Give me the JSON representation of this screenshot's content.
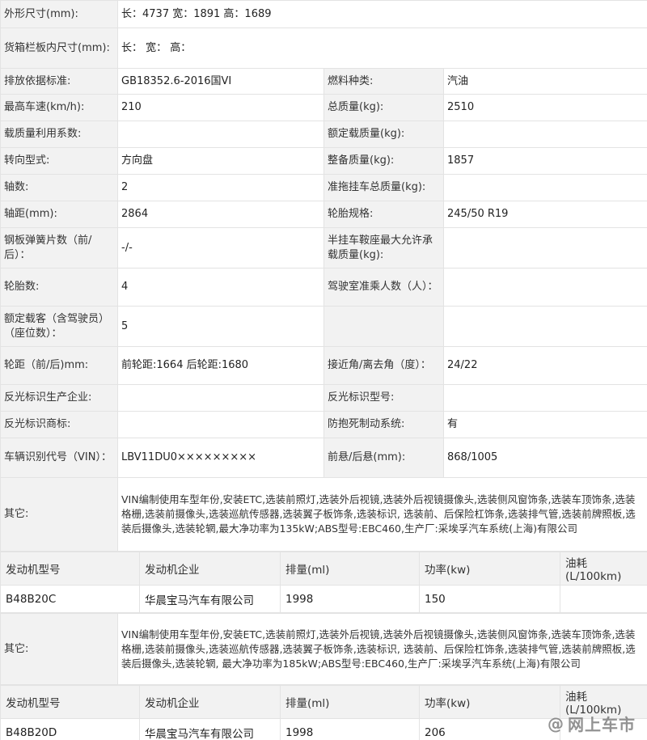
{
  "spec_rows": [
    {
      "type": "span",
      "label": "外形尺寸(mm):",
      "value": "长：4737 宽：1891 高：1689",
      "h": 34
    },
    {
      "type": "span",
      "label": "货箱栏板内尺寸(mm):",
      "value": "长：  宽：  高：",
      "h": 50
    },
    {
      "type": "pair",
      "l1": "排放依据标准:",
      "v1": "GB18352.6-2016国VI",
      "l2": "燃料种类:",
      "v2": "汽油",
      "h": 32
    },
    {
      "type": "pair",
      "l1": "最高车速(km/h):",
      "v1": "210",
      "l2": "总质量(kg):",
      "v2": "2510",
      "h": 33
    },
    {
      "type": "pair",
      "l1": "载质量利用系数:",
      "v1": "",
      "l2": "额定载质量(kg):",
      "v2": "",
      "h": 33
    },
    {
      "type": "pair",
      "l1": "转向型式:",
      "v1": "方向盘",
      "l2": "整备质量(kg):",
      "v2": "1857",
      "h": 33
    },
    {
      "type": "pair",
      "l1": "轴数:",
      "v1": "2",
      "l2": "准拖挂车总质量(kg):",
      "v2": "",
      "h": 33
    },
    {
      "type": "pair",
      "l1": "轴距(mm):",
      "v1": "2864",
      "l2": "轮胎规格:",
      "v2": "245/50 R19",
      "h": 33
    },
    {
      "type": "pair",
      "l1": "钢板弹簧片数（前/后）：",
      "v1": "-/-",
      "l2": "半挂车鞍座最大允许承载质量(kg):",
      "v2": "",
      "h": 50
    },
    {
      "type": "pair",
      "l1": "轮胎数:",
      "v1": "4",
      "l2": "驾驶室准乘人数（人）：",
      "v2": "",
      "h": 47
    },
    {
      "type": "pair",
      "l1": "额定载客（含驾驶员）（座位数）：",
      "v1": "5",
      "l2": "",
      "v2": "",
      "h": 50
    },
    {
      "type": "pair",
      "l1": "轮距（前/后)mm:",
      "v1": "前轮距:1664 后轮距:1680",
      "l2": "接近角/离去角（度）：",
      "v2": "24/22",
      "h": 47
    },
    {
      "type": "pair",
      "l1": "反光标识生产企业:",
      "v1": "",
      "l2": "反光标识型号:",
      "v2": "",
      "h": 33
    },
    {
      "type": "pair",
      "l1": "反光标识商标:",
      "v1": "",
      "l2": "防抱死制动系统:",
      "v2": "有",
      "h": 33
    },
    {
      "type": "pair",
      "l1": "车辆识别代号（VIN）：",
      "v1": "LBV11DU0×××××××××",
      "l2": "前悬/后悬(mm):",
      "v2": "868/1005",
      "h": 49
    },
    {
      "type": "other",
      "label": "其它:",
      "value": "VIN编制使用车型年份,安装ETC,选装前照灯,选装外后视镜,选装外后视镜摄像头,选装侧风窗饰条,选装车顶饰条,选装格栅,选装前摄像头,选装巡航传感器,选装翼子板饰条,选装标识, 选装前、后保险杠饰条,选装排气管,选装前牌照板,选装后摄像头,选装轮辋,最大净功率为135kW;ABS型号:EBC460,生产厂:采埃孚汽车系统(上海)有限公司",
      "h": 91
    }
  ],
  "engine_blocks": [
    {
      "headers": [
        "发动机型号",
        "发动机企业",
        "排量(ml)",
        "功率(kw)",
        "油耗(L/100km)"
      ],
      "values": [
        "B48B20C",
        "华晨宝马汽车有限公司",
        "1998",
        "150",
        ""
      ],
      "other_label": "其它:",
      "other_value": "VIN编制使用车型年份,安装ETC,选装前照灯,选装外后视镜,选装外后视镜摄像头,选装侧风窗饰条,选装车顶饰条,选装格栅,选装前摄像头,选装巡航传感器,选装翼子板饰条,选装标识, 选装前、后保险杠饰条,选装排气管,选装前牌照板,选装后摄像头,选装轮辋, 最大净功率为185kW;ABS型号:EBC460,生产厂:采埃孚汽车系统(上海)有限公司"
    },
    {
      "headers": [
        "发动机型号",
        "发动机企业",
        "排量(ml)",
        "功率(kw)",
        "油耗(L/100km)"
      ],
      "values": [
        "B48B20D",
        "华晨宝马汽车有限公司",
        "1998",
        "206",
        ""
      ]
    }
  ],
  "watermark": {
    "symbol": "@",
    "text": "网上车市"
  }
}
